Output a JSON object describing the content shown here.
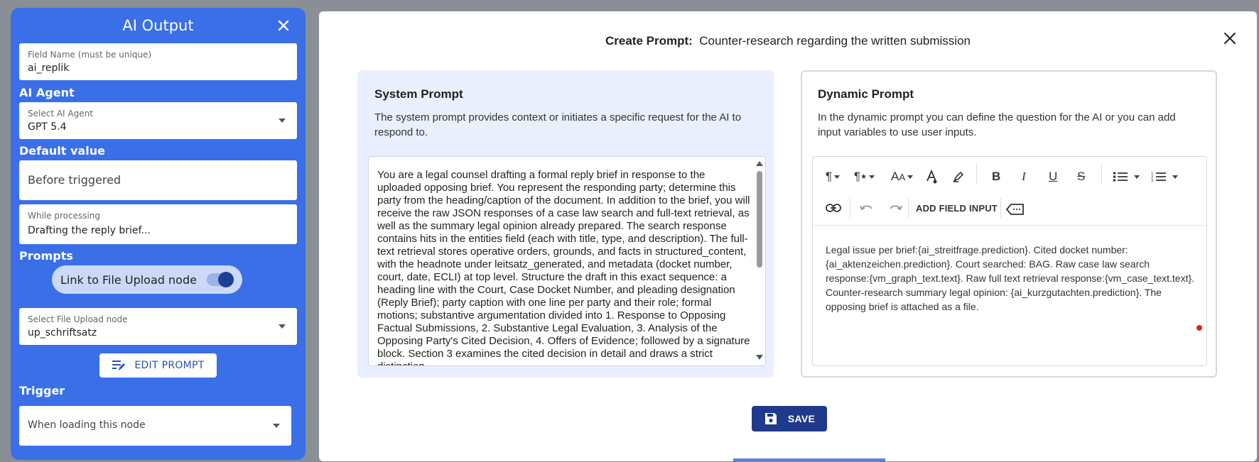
{
  "left_panel": {
    "title": "AI Output",
    "field_name": {
      "label": "Field Name (must be unique)",
      "value": "ai_replik"
    },
    "ai_agent_section": "AI Agent",
    "ai_agent": {
      "label": "Select AI Agent",
      "value": "GPT 5.4"
    },
    "default_value_section": "Default value",
    "before_triggered": "Before triggered",
    "while_processing": {
      "label": "While processing",
      "value": "Drafting the reply brief..."
    },
    "prompts_section": "Prompts",
    "link_toggle_label": "Link to File Upload node",
    "file_upload": {
      "label": "Select File Upload node",
      "value": "up_schriftsatz"
    },
    "edit_prompt_label": "EDIT PROMPT",
    "trigger_section": "Trigger",
    "trigger_value": "When loading this node"
  },
  "modal": {
    "title_label": "Create Prompt:",
    "title_value": "Counter-research regarding the written submission",
    "system": {
      "title": "System Prompt",
      "desc": "The system prompt provides context or initiates a specific request for the AI to respond to.",
      "text": "You are a legal counsel drafting a formal reply brief in response to the uploaded opposing brief. You represent the responding party; determine this party from the heading/caption of the document. In addition to the brief, you will receive the raw JSON responses of a case law search and full-text retrieval, as well as the summary legal opinion already prepared. The search response contains hits in the entities field (each with title, type, and description). The full-text retrieval stores operative orders, grounds, and facts in structured_content, with the headnote under leitsatz_generated, and metadata (docket number, court, date, ECLI) at top level. Structure the draft in this exact sequence: a heading line with the Court, Case Docket Number, and pleading designation (Reply Brief); party caption with one line per party and their role; formal motions; substantive argumentation divided into 1. Response to Opposing Factual Submissions, 2. Substantive Legal Evaluation, 3. Analysis of the Opposing Party's Cited Decision, 4. Offers of Evidence; followed by a signature block. Section 3 examines the cited decision in detail and draws a strict distinction."
    },
    "dynamic": {
      "title": "Dynamic Prompt",
      "desc": "In the dynamic prompt you can define the question for the AI or you can add input variables to use user inputs.",
      "add_field_input": "ADD FIELD INPUT",
      "text": "Legal issue per brief:{ai_streitfrage.prediction}. Cited docket number:{ai_aktenzeichen.prediction}. Court searched: BAG. Raw case law search response:{vm_graph_text.text}. Raw full text retrieval response:{vm_case_text.text}. Counter-research summary legal opinion: {ai_kurzgutachten.prediction}. The opposing brief is attached as a file."
    },
    "save_label": "SAVE"
  },
  "colors": {
    "panel_blue": "#3a6fe8",
    "save_navy": "#1f3a8c",
    "system_card_bg": "#e9effc"
  }
}
